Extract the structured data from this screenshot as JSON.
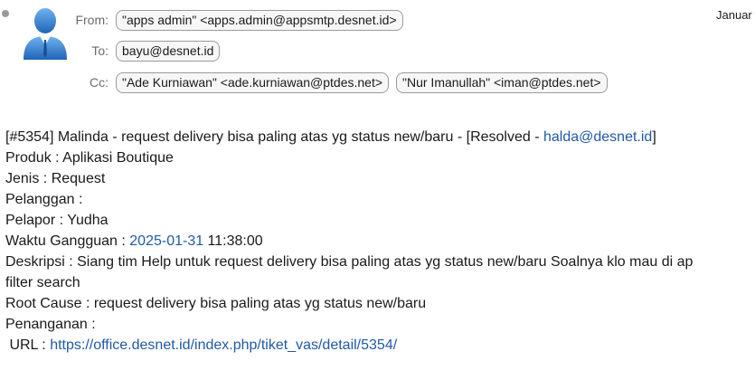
{
  "header": {
    "date": "Januar",
    "from_label": "From:",
    "from": [
      "\"apps admin\" <apps.admin@appsmtp.desnet.id>"
    ],
    "to_label": "To:",
    "to": [
      "bayu@desnet.id"
    ],
    "cc_label": "Cc:",
    "cc": [
      "\"Ade Kurniawan\" <ade.kurniawan@ptdes.net>",
      "\"Nur Imanullah\" <iman@ptdes.net>"
    ]
  },
  "message": {
    "subject_prefix": "[#5354] Malinda - request delivery bisa paling atas yg status new/baru - [Resolved - ",
    "subject_email": "halda@desnet.id",
    "subject_suffix": "]",
    "produk": "Produk : Aplikasi Boutique",
    "jenis": "Jenis : Request",
    "pelanggan": "Pelanggan :",
    "pelapor": "Pelapor : Yudha",
    "waktu_label": "Waktu Gangguan : ",
    "waktu_date": "2025-01-31",
    "waktu_time": " 11:38:00",
    "deskripsi": "Deskripsi : Siang tim Help untuk request delivery bisa paling atas yg status new/baru Soalnya klo mau di ap",
    "deskripsi_cont": "filter search",
    "root_cause": "Root Cause : request delivery bisa paling atas yg status new/baru",
    "penanganan": "Penanganan :",
    "url_label": " URL : ",
    "url": "https://office.desnet.id/index.php/tiket_vas/detail/5354/"
  },
  "colors": {
    "link": "#1f5aa6",
    "pill_border": "#9b9b9b",
    "label": "#6b6b6b",
    "avatar": "#2f7fd0"
  }
}
